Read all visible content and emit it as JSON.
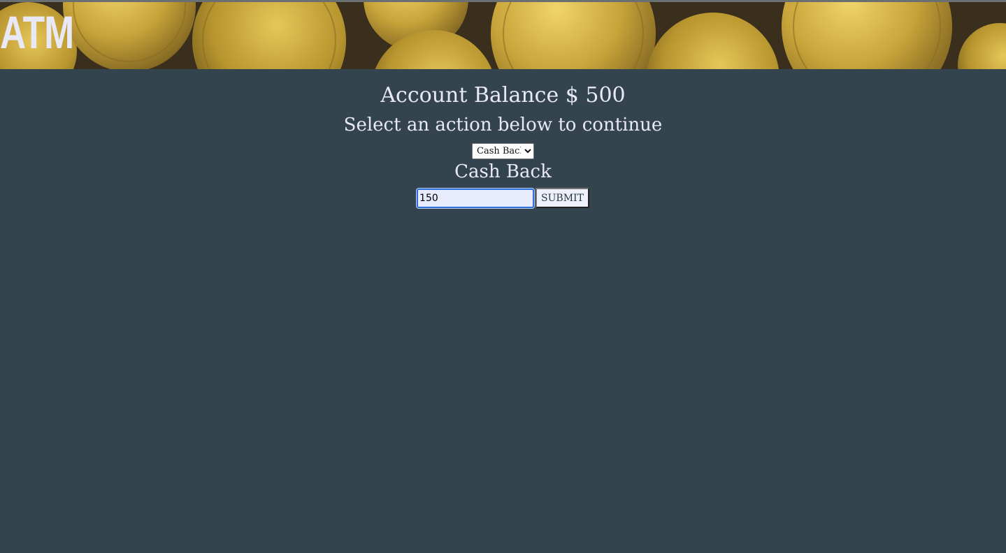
{
  "header": {
    "brand": "ATM"
  },
  "main": {
    "balance_text": "Account Balance $ 500",
    "prompt": "Select an action below to continue",
    "action_select": {
      "selected": "Cash Back"
    },
    "section_title": "Cash Back",
    "amount_input": {
      "value": "150"
    },
    "submit_label": "SUBMIT"
  },
  "colors": {
    "background": "#34444f",
    "text": "#e8e8f6",
    "coin_gold": "#c9a43a"
  }
}
